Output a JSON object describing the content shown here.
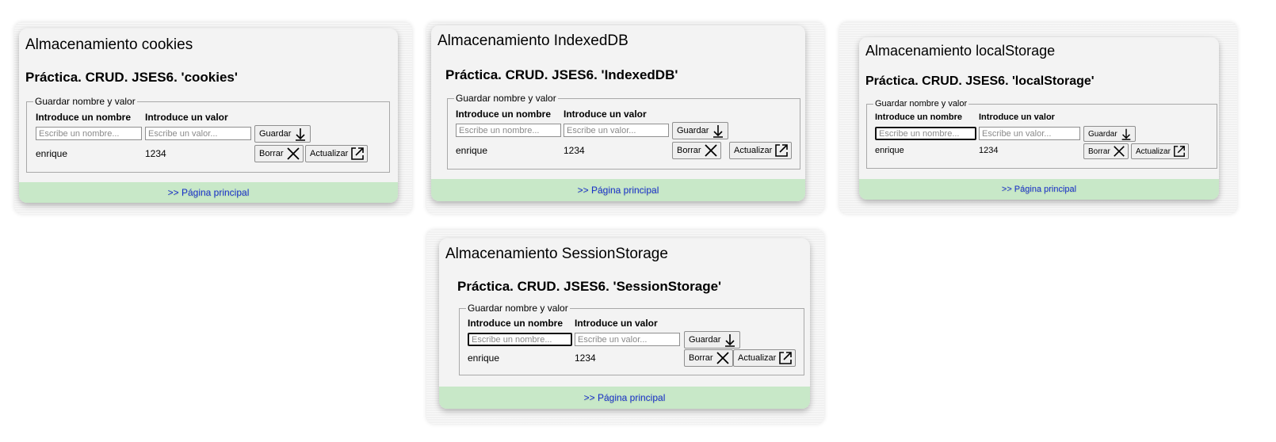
{
  "panels": [
    {
      "title": "Almacenamiento cookies",
      "heading": "Práctica. CRUD. JSES6. 'cookies'",
      "legend": "Guardar nombre y valor",
      "name_label": "Introduce un nombre",
      "value_label": "Introduce un valor",
      "name_placeholder": "Escribe un nombre...",
      "value_placeholder": "Escribe un valor...",
      "save_label": "Guardar",
      "record": {
        "name": "enrique",
        "value": "1234"
      },
      "delete_label": "Borrar",
      "update_label": "Actualizar",
      "footer_link": ">> Página principal"
    },
    {
      "title": "Almacenamiento IndexedDB",
      "heading": "Práctica. CRUD. JSES6. 'IndexedDB'",
      "legend": "Guardar nombre y valor",
      "name_label": "Introduce un nombre",
      "value_label": "Introduce un valor",
      "name_placeholder": "Escribe un nombre...",
      "value_placeholder": "Escribe un valor...",
      "save_label": "Guardar",
      "record": {
        "name": "enrique",
        "value": "1234"
      },
      "delete_label": "Borrar",
      "update_label": "Actualizar",
      "footer_link": ">> Página principal"
    },
    {
      "title": "Almacenamiento localStorage",
      "heading": "Práctica. CRUD. JSES6. 'localStorage'",
      "legend": "Guardar nombre y valor",
      "name_label": "Introduce un nombre",
      "value_label": "Introduce un valor",
      "name_placeholder": "Escribe un nombre...",
      "value_placeholder": "Escribe un valor...",
      "save_label": "Guardar",
      "record": {
        "name": "enrique",
        "value": "1234"
      },
      "delete_label": "Borrar",
      "update_label": "Actualizar",
      "footer_link": ">> Página principal"
    },
    {
      "title": "Almacenamiento SessionStorage",
      "heading": "Práctica. CRUD. JSES6. 'SessionStorage'",
      "legend": "Guardar nombre y valor",
      "name_label": "Introduce un nombre",
      "value_label": "Introduce un valor",
      "name_placeholder": "Escribe un nombre...",
      "value_placeholder": "Escribe un valor...",
      "save_label": "Guardar",
      "record": {
        "name": "enrique",
        "value": "1234"
      },
      "delete_label": "Borrar",
      "update_label": "Actualizar",
      "footer_link": ">> Página principal"
    }
  ],
  "colors": {
    "footer_bg": "#c8e8c8",
    "link": "#1a33cc"
  },
  "icons": {
    "save": "arrow-down-icon",
    "delete": "x-mark-icon",
    "update": "external-link-icon"
  }
}
